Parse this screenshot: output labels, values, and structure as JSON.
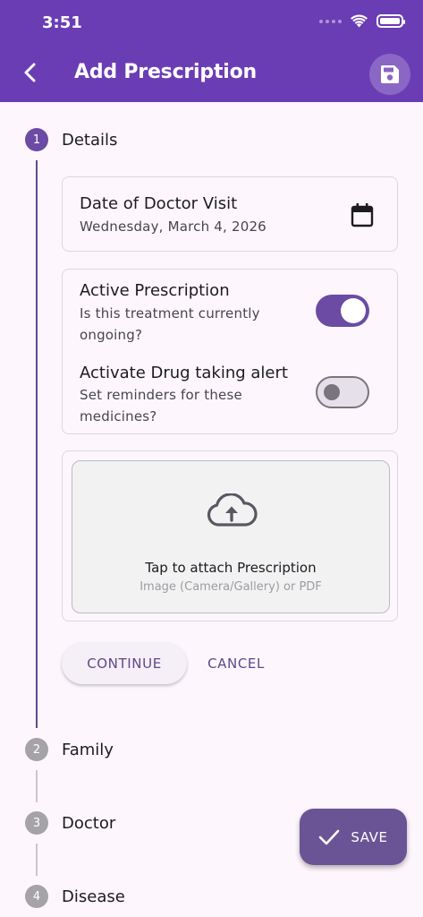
{
  "status_bar": {
    "time": "3:51"
  },
  "header": {
    "title": "Add Prescription",
    "back_icon": "arrow-back-icon",
    "save_icon": "floppy-disk-icon"
  },
  "steps": [
    {
      "number": "1",
      "label": "Details",
      "state": "active"
    },
    {
      "number": "2",
      "label": "Family",
      "state": "inactive"
    },
    {
      "number": "3",
      "label": "Doctor",
      "state": "inactive"
    },
    {
      "number": "4",
      "label": "Disease",
      "state": "inactive"
    }
  ],
  "visit_date": {
    "label": "Date of Doctor Visit",
    "value": "Wednesday, March 4, 2026",
    "icon": "calendar-icon"
  },
  "toggles": [
    {
      "label": "Active Prescription",
      "description_line1": "Is this treatment currently",
      "description_line2": "ongoing?",
      "checked": true
    },
    {
      "label": "Activate Drug taking alert",
      "description_line1": "Set reminders for these",
      "description_line2": "medicines?",
      "checked": false
    }
  ],
  "attachment": {
    "title": "Tap to attach Prescription",
    "subtitle": "Image (Camera/Gallery) or PDF",
    "icon": "cloud-upload-icon"
  },
  "actions": {
    "continue_label": "CONTINUE",
    "cancel_label": "CANCEL"
  },
  "fab": {
    "label": "SAVE",
    "icon": "check-icon"
  },
  "colors": {
    "app_bar": "#6a3db5",
    "accent": "#6b4ba3",
    "background": "#fdf7fd",
    "fab": "#6b5495"
  }
}
